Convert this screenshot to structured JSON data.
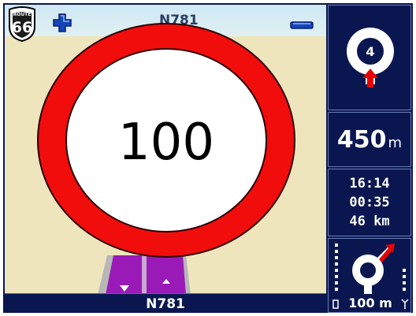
{
  "map": {
    "road_top_label": "N781",
    "route_shield": {
      "top": "ROUTE",
      "number": "66"
    },
    "speed_limit": "100",
    "colors": {
      "sign_red": "#f20d0d",
      "sign_white": "#ffffff",
      "map_ground": "#efe5bd",
      "road_purple": "#9a1ab8"
    }
  },
  "bottom_bar": {
    "street_name": "N781"
  },
  "panel": {
    "roundabout_exit": "4",
    "distance_value": "450",
    "distance_unit": "m",
    "trip": {
      "time": "16:14",
      "remaining_time": "00:35",
      "remaining_distance": "46 km"
    },
    "following_distance": "100 m"
  },
  "icons": [
    "route66-shield-icon",
    "zoom-in-icon",
    "zoom-out-icon",
    "roundabout-exit-icon",
    "roundabout-follow-icon",
    "gps-icon",
    "signal-icon"
  ]
}
